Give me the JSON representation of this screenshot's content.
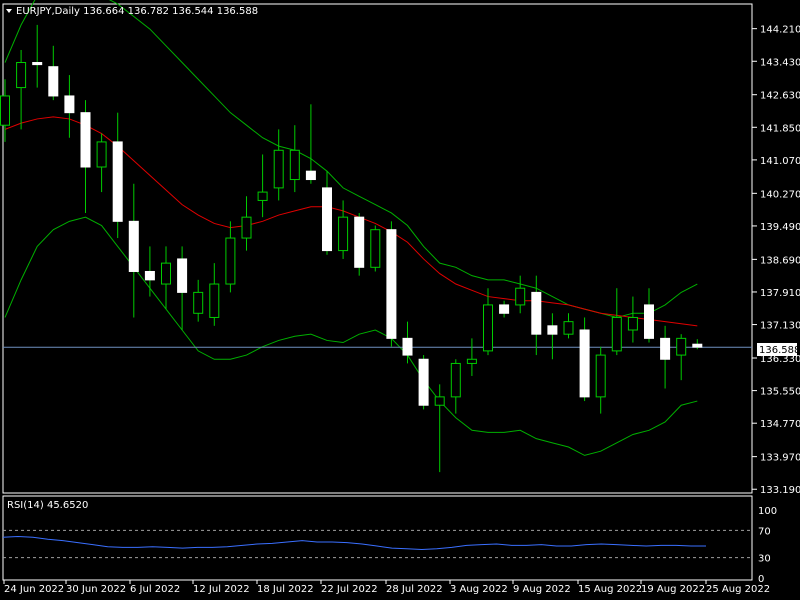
{
  "header": {
    "symbol_line": "EURJPY,Daily  136.664 136.782 136.544 136.588"
  },
  "price_tag": "136.588",
  "colors": {
    "background": "#000000",
    "frame": "#ffffff",
    "bull_candle": "#ffffff",
    "bear_candle": "#ffffff",
    "wick": "#00cc00",
    "ma": "#e00000",
    "band": "#00b000",
    "price_line": "#6f8fbf",
    "rsi_line": "#3a6fff",
    "rsi_levels": "#a0a0a0"
  },
  "chart_data": [
    {
      "type": "candlestick",
      "title": "EURJPY,Daily",
      "y_ticks": [
        "144.210",
        "143.430",
        "142.630",
        "141.850",
        "141.070",
        "140.270",
        "139.490",
        "138.690",
        "137.910",
        "137.130",
        "136.330",
        "135.550",
        "134.770",
        "133.970",
        "133.190"
      ],
      "x_ticks": [
        "24 Jun 2022",
        "30 Jun 2022",
        "6 Jul 2022",
        "12 Jul 2022",
        "18 Jul 2022",
        "22 Jul 2022",
        "28 Jul 2022",
        "3 Aug 2022",
        "9 Aug 2022",
        "15 Aug 2022",
        "19 Aug 2022",
        "25 Aug 2022"
      ],
      "ylim": [
        133.1,
        144.8
      ],
      "last_price": 136.588,
      "candles": [
        {
          "o": 141.9,
          "h": 143.0,
          "l": 141.5,
          "c": 142.6
        },
        {
          "o": 142.8,
          "h": 143.7,
          "l": 141.8,
          "c": 143.4
        },
        {
          "o": 143.4,
          "h": 144.3,
          "l": 142.8,
          "c": 143.35
        },
        {
          "o": 143.3,
          "h": 143.8,
          "l": 142.5,
          "c": 142.6
        },
        {
          "o": 142.6,
          "h": 143.1,
          "l": 141.6,
          "c": 142.2
        },
        {
          "o": 142.2,
          "h": 142.5,
          "l": 139.8,
          "c": 140.9
        },
        {
          "o": 140.9,
          "h": 141.7,
          "l": 140.3,
          "c": 141.5
        },
        {
          "o": 141.5,
          "h": 142.2,
          "l": 139.2,
          "c": 139.6
        },
        {
          "o": 139.6,
          "h": 140.5,
          "l": 137.3,
          "c": 138.4
        },
        {
          "o": 138.4,
          "h": 139.0,
          "l": 137.8,
          "c": 138.2
        },
        {
          "o": 138.1,
          "h": 139.0,
          "l": 137.5,
          "c": 138.6
        },
        {
          "o": 138.7,
          "h": 139.0,
          "l": 137.0,
          "c": 137.9
        },
        {
          "o": 137.4,
          "h": 138.2,
          "l": 137.2,
          "c": 137.9
        },
        {
          "o": 137.3,
          "h": 138.6,
          "l": 137.1,
          "c": 138.1
        },
        {
          "o": 138.1,
          "h": 139.6,
          "l": 137.9,
          "c": 139.2
        },
        {
          "o": 139.2,
          "h": 140.2,
          "l": 138.9,
          "c": 139.7
        },
        {
          "o": 140.1,
          "h": 141.2,
          "l": 139.7,
          "c": 140.3
        },
        {
          "o": 140.4,
          "h": 141.8,
          "l": 140.1,
          "c": 141.3
        },
        {
          "o": 140.6,
          "h": 141.9,
          "l": 140.3,
          "c": 141.3
        },
        {
          "o": 140.8,
          "h": 142.4,
          "l": 140.5,
          "c": 140.6
        },
        {
          "o": 140.4,
          "h": 140.8,
          "l": 138.8,
          "c": 138.9
        },
        {
          "o": 138.9,
          "h": 140.1,
          "l": 138.7,
          "c": 139.7
        },
        {
          "o": 139.7,
          "h": 139.8,
          "l": 138.3,
          "c": 138.5
        },
        {
          "o": 138.5,
          "h": 139.5,
          "l": 138.4,
          "c": 139.4
        },
        {
          "o": 139.4,
          "h": 139.6,
          "l": 136.6,
          "c": 136.8
        },
        {
          "o": 136.8,
          "h": 137.2,
          "l": 136.2,
          "c": 136.4
        },
        {
          "o": 136.3,
          "h": 136.4,
          "l": 135.1,
          "c": 135.2
        },
        {
          "o": 135.2,
          "h": 135.7,
          "l": 133.6,
          "c": 135.4
        },
        {
          "o": 135.4,
          "h": 136.3,
          "l": 135.0,
          "c": 136.2
        },
        {
          "o": 136.2,
          "h": 136.8,
          "l": 135.9,
          "c": 136.3
        },
        {
          "o": 136.5,
          "h": 138.0,
          "l": 136.4,
          "c": 137.6
        },
        {
          "o": 137.6,
          "h": 137.7,
          "l": 137.3,
          "c": 137.4
        },
        {
          "o": 137.6,
          "h": 138.3,
          "l": 137.4,
          "c": 138.0
        },
        {
          "o": 137.9,
          "h": 138.3,
          "l": 136.4,
          "c": 136.9
        },
        {
          "o": 137.1,
          "h": 137.4,
          "l": 136.3,
          "c": 136.9
        },
        {
          "o": 136.9,
          "h": 137.4,
          "l": 136.8,
          "c": 137.2
        },
        {
          "o": 137.0,
          "h": 137.3,
          "l": 135.3,
          "c": 135.4
        },
        {
          "o": 135.4,
          "h": 136.6,
          "l": 135.0,
          "c": 136.4
        },
        {
          "o": 136.5,
          "h": 138.0,
          "l": 136.4,
          "c": 137.3
        },
        {
          "o": 137.0,
          "h": 137.8,
          "l": 136.7,
          "c": 137.3
        },
        {
          "o": 137.6,
          "h": 138.0,
          "l": 136.7,
          "c": 136.8
        },
        {
          "o": 136.8,
          "h": 137.1,
          "l": 135.6,
          "c": 136.3
        },
        {
          "o": 136.4,
          "h": 136.9,
          "l": 135.8,
          "c": 136.8
        },
        {
          "o": 136.66,
          "h": 136.78,
          "l": 136.54,
          "c": 136.59
        }
      ],
      "ma": [
        141.8,
        141.95,
        142.05,
        142.1,
        142.05,
        141.9,
        141.7,
        141.4,
        141.05,
        140.7,
        140.35,
        140.0,
        139.75,
        139.55,
        139.45,
        139.5,
        139.6,
        139.75,
        139.85,
        139.95,
        139.95,
        139.85,
        139.7,
        139.55,
        139.35,
        139.1,
        138.7,
        138.35,
        138.1,
        137.95,
        137.8,
        137.75,
        137.7,
        137.7,
        137.65,
        137.6,
        137.5,
        137.4,
        137.35,
        137.3,
        137.25,
        137.2,
        137.15,
        137.1
      ],
      "band_upper": [
        143.4,
        144.3,
        145.0,
        145.2,
        145.3,
        145.2,
        145.0,
        144.8,
        144.5,
        144.2,
        143.8,
        143.4,
        143.0,
        142.6,
        142.2,
        141.9,
        141.6,
        141.4,
        141.3,
        141.1,
        140.8,
        140.4,
        140.2,
        140.0,
        139.8,
        139.5,
        139.0,
        138.6,
        138.5,
        138.3,
        138.2,
        138.2,
        138.1,
        138.0,
        137.8,
        137.6,
        137.5,
        137.4,
        137.3,
        137.4,
        137.4,
        137.6,
        137.9,
        138.1
      ],
      "band_lower": [
        137.3,
        138.2,
        139.0,
        139.4,
        139.6,
        139.7,
        139.5,
        139.0,
        138.5,
        138.0,
        137.5,
        137.0,
        136.5,
        136.3,
        136.3,
        136.4,
        136.6,
        136.75,
        136.85,
        136.9,
        136.75,
        136.7,
        136.9,
        137.0,
        136.8,
        136.4,
        135.8,
        135.3,
        134.9,
        134.6,
        134.55,
        134.55,
        134.6,
        134.4,
        134.3,
        134.2,
        134.0,
        134.1,
        134.3,
        134.5,
        134.6,
        134.8,
        135.2,
        135.3
      ]
    },
    {
      "type": "line",
      "title": "RSI(14) 45.6520",
      "y_ticks": [
        "100",
        "70",
        "30",
        "0"
      ],
      "levels": [
        70,
        30
      ],
      "ylim": [
        0,
        100
      ],
      "values": [
        60,
        61,
        60,
        57,
        55,
        52,
        49,
        46,
        45,
        45,
        46,
        45,
        44,
        45,
        45,
        46,
        48,
        50,
        51,
        53,
        55,
        53,
        53,
        52,
        50,
        47,
        44,
        43,
        42,
        43,
        45,
        48,
        49,
        50,
        48,
        48,
        49,
        47,
        47,
        49,
        50,
        49,
        48,
        47,
        48,
        48,
        47,
        47
      ]
    }
  ]
}
